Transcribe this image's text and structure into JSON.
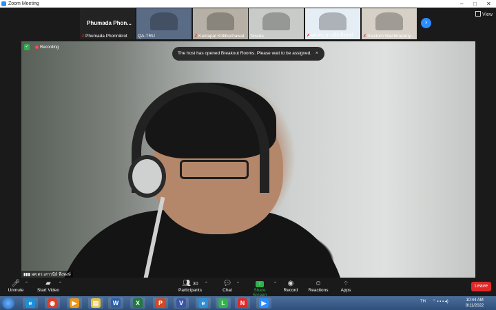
{
  "window": {
    "title": "Zoom Meeting",
    "controls": [
      "–",
      "□",
      "✕"
    ]
  },
  "view": {
    "label": "View"
  },
  "thumbnails": [
    {
      "type": "name",
      "name": "Phumada Phonnikrot",
      "big_name": "Phumada  Phon...",
      "muted": true,
      "bg": "#232323"
    },
    {
      "type": "video",
      "name": "QA-TRU",
      "muted": false,
      "bg": "#5a6b86"
    },
    {
      "type": "video",
      "name": "Kantapat Kittibuchawal",
      "muted": true,
      "bg": "#b7b0a6"
    },
    {
      "type": "video",
      "name": "Terada",
      "muted": false,
      "bg": "#c9cbc8"
    },
    {
      "type": "video",
      "name": "ผศ.ดร.เสาวนีย์ พึ่งพงษ์",
      "muted": true,
      "bg": "#e6eef5"
    },
    {
      "type": "video",
      "name": "Sasitorn Wachirapany...",
      "muted": true,
      "bg": "#d6d0c7"
    }
  ],
  "recording": {
    "label": "Recording"
  },
  "toast": {
    "text": "The host has opened Breakout Rooms. Please wait to be assigned.",
    "close": "×"
  },
  "speaker": {
    "name": "ผศ.ดร.เสาวนีย์ พึ่งพงษ์"
  },
  "controls": {
    "unmute": "Unmute",
    "start_video": "Start Video",
    "participants": "Participants",
    "participants_count": "30",
    "chat": "Chat",
    "share_screen": "Share Screen",
    "record": "Record",
    "reactions": "Reactions",
    "apps": "Apps",
    "leave": "Leave"
  },
  "colors": {
    "accent_blue": "#2d8cff",
    "leave_red": "#e02828",
    "share_green": "#2fb14b",
    "toolbar_bg": "#1a1a1a"
  },
  "taskbar": {
    "apps": [
      {
        "icon": "ie-icon",
        "glyph": "e",
        "color": "#1d8ed8"
      },
      {
        "icon": "chrome-icon",
        "glyph": "◉",
        "color": "#d93f2c"
      },
      {
        "icon": "media-icon",
        "glyph": "▶",
        "color": "#e8961e"
      },
      {
        "icon": "explorer-icon",
        "glyph": "▤",
        "color": "#e8c04a"
      },
      {
        "icon": "word-icon",
        "glyph": "W",
        "color": "#2b5faa"
      },
      {
        "icon": "excel-icon",
        "glyph": "X",
        "color": "#1f7a3e"
      },
      {
        "icon": "powerpoint-icon",
        "glyph": "P",
        "color": "#d04a25"
      },
      {
        "icon": "visio-icon",
        "glyph": "V",
        "color": "#3955a3"
      },
      {
        "icon": "edge-icon",
        "glyph": "e",
        "color": "#2a8fd6"
      },
      {
        "icon": "line-icon",
        "glyph": "L",
        "color": "#2fb14b"
      },
      {
        "icon": "nitro-icon",
        "glyph": "N",
        "color": "#e02828"
      },
      {
        "icon": "zoom-icon",
        "glyph": "▶",
        "color": "#2d8cff"
      }
    ],
    "lang": "TH",
    "time": "10:44 AM",
    "date": "8/11/2022"
  }
}
